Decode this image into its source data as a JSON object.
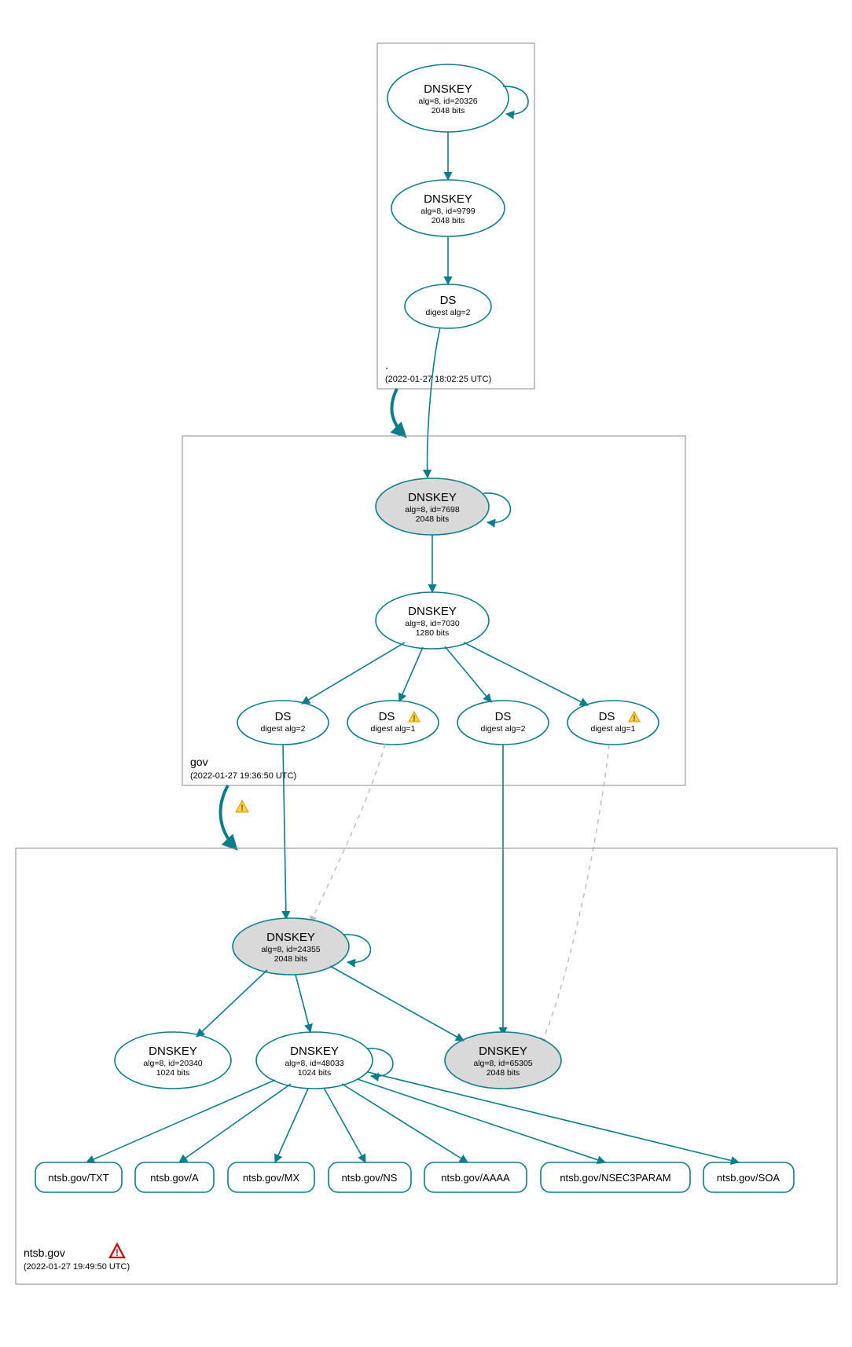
{
  "colors": {
    "stroke": "#0d7d8c",
    "fillGrey": "#d9d9d9"
  },
  "zones": {
    "root": {
      "label": ".",
      "timestamp": "(2022-01-27 18:02:25 UTC)"
    },
    "gov": {
      "label": "gov",
      "timestamp": "(2022-01-27 19:36:50 UTC)"
    },
    "ntsb": {
      "label": "ntsb.gov",
      "timestamp": "(2022-01-27 19:49:50 UTC)"
    }
  },
  "nodes": {
    "rootKsk": {
      "title": "DNSKEY",
      "line2": "alg=8, id=20326",
      "line3": "2048 bits"
    },
    "rootZsk": {
      "title": "DNSKEY",
      "line2": "alg=8, id=9799",
      "line3": "2048 bits"
    },
    "rootDs": {
      "title": "DS",
      "line2": "digest alg=2",
      "line3": ""
    },
    "govKsk": {
      "title": "DNSKEY",
      "line2": "alg=8, id=7698",
      "line3": "2048 bits"
    },
    "govZsk": {
      "title": "DNSKEY",
      "line2": "alg=8, id=7030",
      "line3": "1280 bits"
    },
    "govDs1": {
      "title": "DS",
      "line2": "digest alg=2",
      "line3": ""
    },
    "govDs2": {
      "title": "DS",
      "line2": "digest alg=1",
      "line3": ""
    },
    "govDs3": {
      "title": "DS",
      "line2": "digest alg=2",
      "line3": ""
    },
    "govDs4": {
      "title": "DS",
      "line2": "digest alg=1",
      "line3": ""
    },
    "ntsbKsk": {
      "title": "DNSKEY",
      "line2": "alg=8, id=24355",
      "line3": "2048 bits"
    },
    "ntsbK2": {
      "title": "DNSKEY",
      "line2": "alg=8, id=20340",
      "line3": "1024 bits"
    },
    "ntsbZsk": {
      "title": "DNSKEY",
      "line2": "alg=8, id=48033",
      "line3": "1024 bits"
    },
    "ntsbK4": {
      "title": "DNSKEY",
      "line2": "alg=8, id=65305",
      "line3": "2048 bits"
    }
  },
  "rr": {
    "txt": "ntsb.gov/TXT",
    "a": "ntsb.gov/A",
    "mx": "ntsb.gov/MX",
    "ns": "ntsb.gov/NS",
    "aaaa": "ntsb.gov/AAAA",
    "n3p": "ntsb.gov/NSEC3PARAM",
    "soa": "ntsb.gov/SOA"
  }
}
